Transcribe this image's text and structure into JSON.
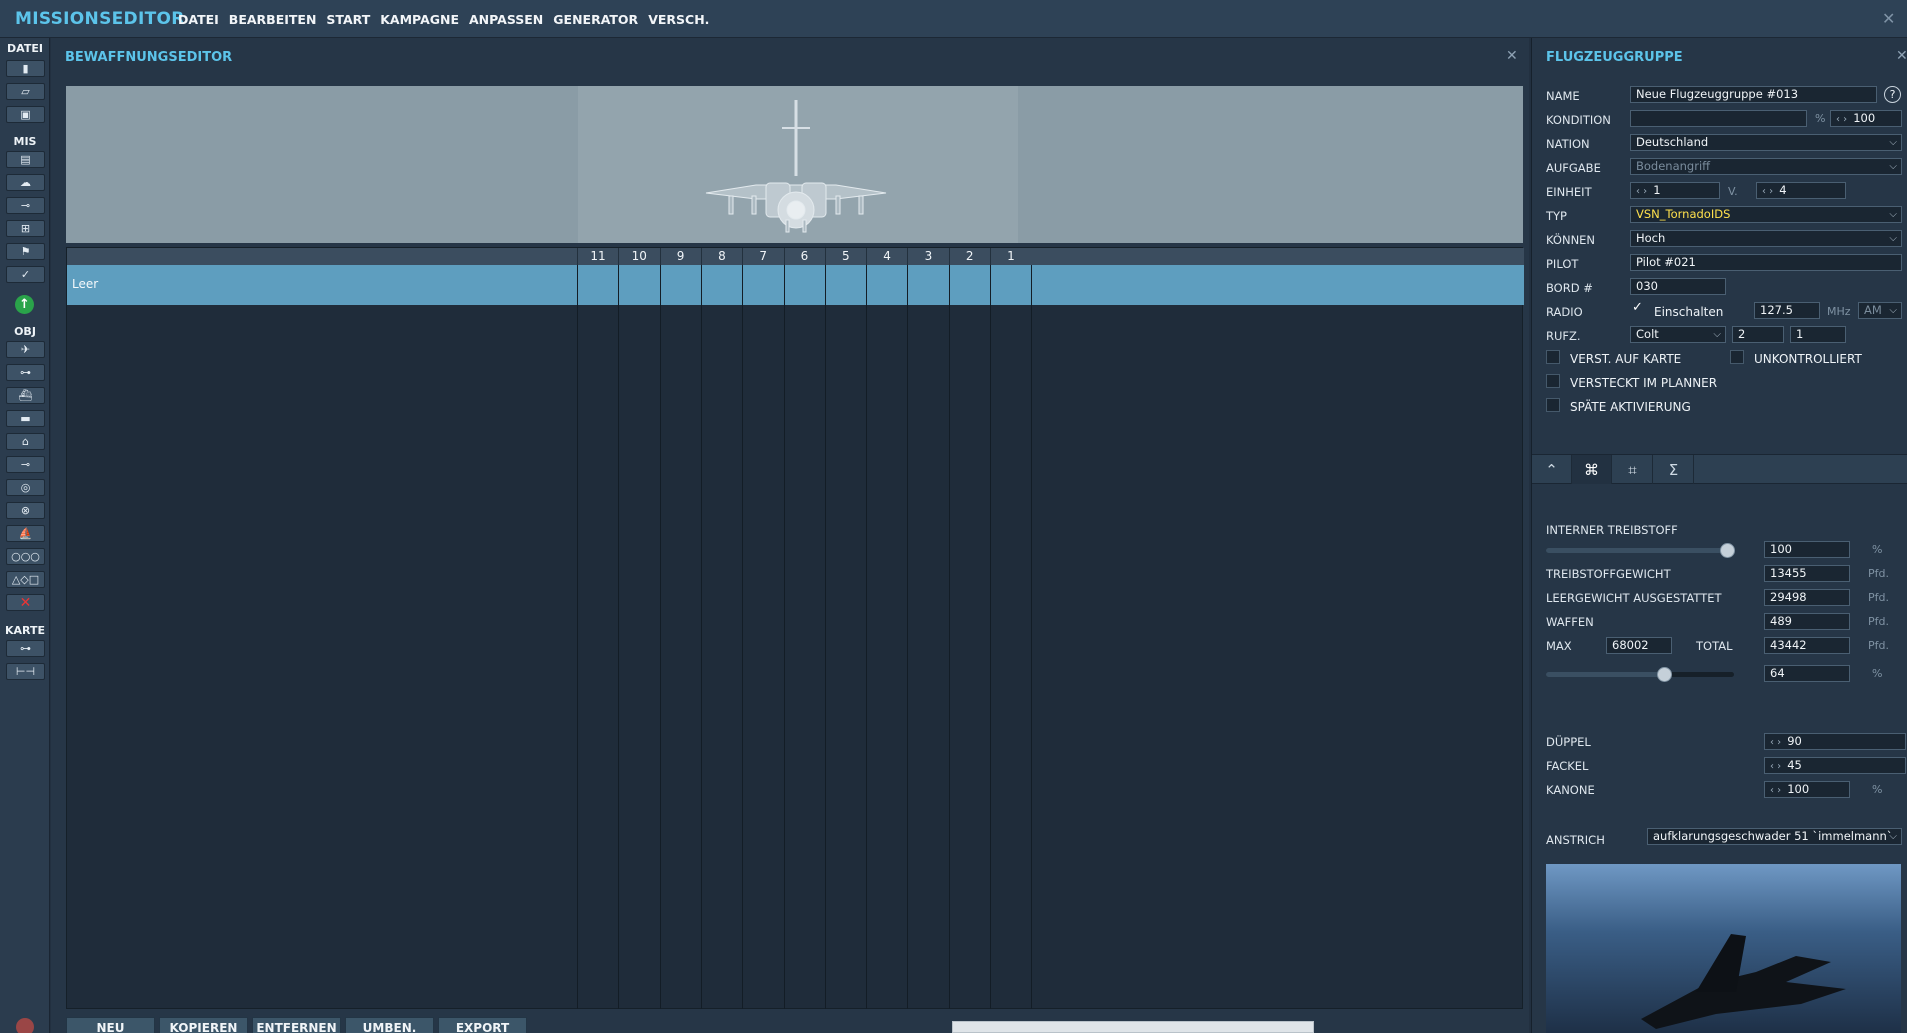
{
  "app": {
    "title": "MISSIONSEDITOR",
    "menu": [
      "DATEI",
      "BEARBEITEN",
      "START",
      "KAMPAGNE",
      "ANPASSEN",
      "GENERATOR",
      "VERSCH."
    ]
  },
  "toolbar": {
    "section_file": "DATEI",
    "section_mis": "MIS",
    "section_obj": "OBJ",
    "section_map": "KARTE"
  },
  "payload_editor": {
    "title": "BEWAFFNUNGSEDITOR",
    "pylons": [
      "11",
      "10",
      "9",
      "8",
      "7",
      "6",
      "5",
      "4",
      "3",
      "2",
      "1"
    ],
    "rows": [
      {
        "name": "Leer"
      }
    ],
    "buttons": [
      "NEU",
      "KOPIEREN",
      "ENTFERNEN",
      "UMBEN.",
      "EXPORT"
    ]
  },
  "group": {
    "title": "FLUGZEUGGRUPPE",
    "name_label": "NAME",
    "name_value": "Neue Flugzeuggruppe #013",
    "help": "?",
    "condition_label": "KONDITION",
    "condition_unit": "%",
    "condition_value": "100",
    "country_label": "NATION",
    "country_value": "Deutschland",
    "task_label": "AUFGABE",
    "task_value": "Bodenangriff",
    "unit_label": "EINHEIT",
    "unit_value": "1",
    "unit_of": "V.",
    "unit_total": "4",
    "type_label": "TYP",
    "type_value": "VSN_TornadoIDS",
    "skill_label": "KÖNNEN",
    "skill_value": "Hoch",
    "pilot_label": "PILOT",
    "pilot_value": "Pilot #021",
    "board_label": "BORD #",
    "board_value": "030",
    "radio_label": "RADIO",
    "radio_enable": "Einschalten",
    "radio_freq": "127.5",
    "radio_unit": "MHz",
    "radio_mod": "AM",
    "callsign_label": "RUFZ.",
    "callsign_value": "Colt",
    "callsign_num1": "2",
    "callsign_num2": "1",
    "cb_hidden_map": "VERST. AUF KARTE",
    "cb_uncontrolled": "UNKONTROLLIERT",
    "cb_hidden_planner": "VERSTECKT IM PLANNER",
    "cb_late_activation": "SPÄTE AKTIVIERUNG"
  },
  "fuel": {
    "internal_label": "INTERNER TREIBSTOFF",
    "internal_value": "100",
    "internal_fraction": 1.0,
    "pct": "%",
    "fuel_weight_label": "TREIBSTOFFGEWICHT",
    "fuel_weight": "13455",
    "empty_label": "LEERGEWICHT AUSGESTATTET",
    "empty_weight": "29498",
    "weapons_label": "WAFFEN",
    "weapons_weight": "489",
    "max_label": "MAX",
    "max_value": "68002",
    "total_label": "TOTAL",
    "total_value": "43442",
    "load_value": "64",
    "load_fraction": 0.64,
    "lb": "Pfd.",
    "chaff_label": "DÜPPEL",
    "chaff_value": "90",
    "flare_label": "FACKEL",
    "flare_value": "45",
    "gun_label": "KANONE",
    "gun_value": "100",
    "livery_label": "ANSTRICH",
    "livery_value": "aufklarungsgeschwader 51 `immelmann`"
  },
  "colors": {
    "accent": "#5cc4ea",
    "selected_row": "#5e9ebf",
    "type_text": "#ffe14d"
  }
}
